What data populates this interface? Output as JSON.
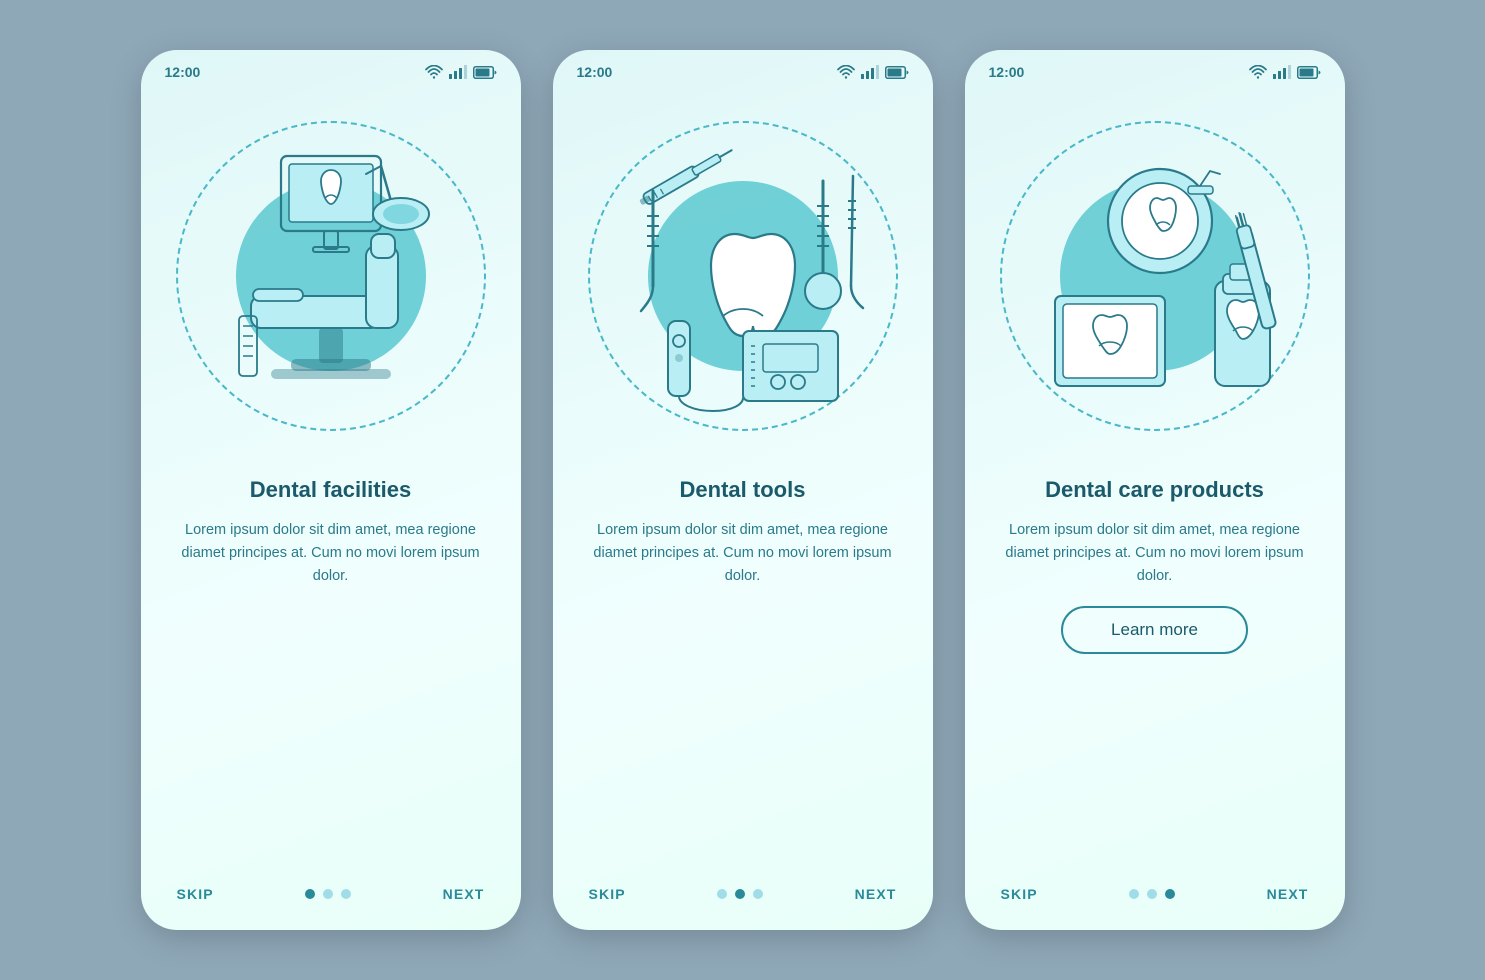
{
  "background_color": "#8fa8b8",
  "phones": [
    {
      "id": "phone-1",
      "status": {
        "time": "12:00"
      },
      "title": "Dental facilities",
      "body": "Lorem ipsum dolor sit dim amet, mea regione diamet principes at. Cum no movi lorem ipsum dolor.",
      "has_learn_more": false,
      "dots": [
        true,
        false,
        false
      ],
      "nav": {
        "skip": "SKIP",
        "next": "NEXT"
      }
    },
    {
      "id": "phone-2",
      "status": {
        "time": "12:00"
      },
      "title": "Dental tools",
      "body": "Lorem ipsum dolor sit dim amet, mea regione diamet principes at. Cum no movi lorem ipsum dolor.",
      "has_learn_more": false,
      "dots": [
        false,
        true,
        false
      ],
      "nav": {
        "skip": "SKIP",
        "next": "NEXT"
      }
    },
    {
      "id": "phone-3",
      "status": {
        "time": "12:00"
      },
      "title": "Dental care products",
      "body": "Lorem ipsum dolor sit dim amet, mea regione diamet principes at. Cum no movi lorem ipsum dolor.",
      "has_learn_more": true,
      "learn_more_label": "Learn more",
      "dots": [
        false,
        false,
        true
      ],
      "nav": {
        "skip": "SKIP",
        "next": "NEXT"
      }
    }
  ]
}
